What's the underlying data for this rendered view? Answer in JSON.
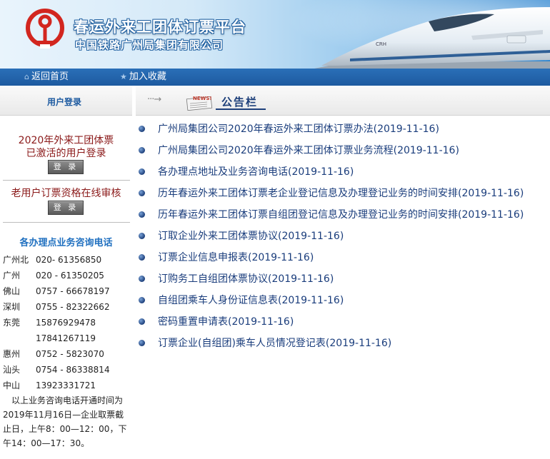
{
  "header": {
    "title": "春运外来工团体订票平台",
    "subtitle": "中国铁路广州局集团有限公司",
    "train_label": "CRH"
  },
  "nav": {
    "home": "返回首页",
    "favorite": "加入收藏"
  },
  "left": {
    "login_heading": "用户登录",
    "block1_line1": "2020年外来工团体票",
    "block1_line2": "已激活的用户登录",
    "login_button": "登 录",
    "block2_title": "老用户订票资格在线审核",
    "contact_title": "各办理点业务咨询电话",
    "contacts": [
      {
        "city": "广州北",
        "phone": "020- 61356850"
      },
      {
        "city": "广州",
        "phone": "020 - 61350205"
      },
      {
        "city": "佛山",
        "phone": "0757 - 66678197"
      },
      {
        "city": "深圳",
        "phone": "0755 - 82322662"
      },
      {
        "city": "东莞",
        "phone": "15876929478"
      },
      {
        "city": "",
        "phone": "17841267119"
      },
      {
        "city": "惠州",
        "phone": "0752 - 5823070"
      },
      {
        "city": "汕头",
        "phone": "0754 - 86338814"
      },
      {
        "city": "中山",
        "phone": "13923331721"
      }
    ],
    "note": "以上业务咨询电话开通时间为2019年11月16日—企业取票截止日，上午8：00—12：00，下午14：00—17：30。"
  },
  "notice": {
    "news_badge": "NEWS!",
    "title": "公告栏",
    "items": [
      "广州局集团公司2020年春运外来工团体订票办法(2019-11-16)",
      "广州局集团公司2020年春运外来工团体订票业务流程(2019-11-16)",
      "各办理点地址及业务咨询电话(2019-11-16)",
      "历年春运外来工团体订票老企业登记信息及办理登记业务的时间安排(2019-11-16)",
      "历年春运外来工团体订票自组团登记信息及办理登记业务的时间安排(2019-11-16)",
      "订取企业外来工团体票协议(2019-11-16)",
      "订票企业信息申报表(2019-11-16)",
      "订购务工自组团体票协议(2019-11-16)",
      "自组团乘车人身份证信息表(2019-11-16)",
      "密码重置申请表(2019-11-16)",
      "订票企业(自组团)乘车人员情况登记表(2019-11-16)"
    ]
  },
  "colors": {
    "nav_bg": "#1d5aa0",
    "logo_red": "#d2261f",
    "link_blue": "#1a3d7c",
    "heading_red": "#8b1a1a"
  }
}
